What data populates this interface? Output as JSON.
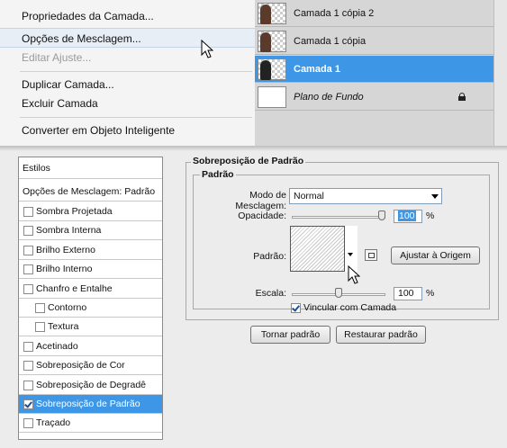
{
  "context_menu": {
    "items": [
      {
        "label": "Propriedades da Camada...",
        "state": "normal"
      },
      {
        "label": "Opções de Mesclagem...",
        "state": "highlighted"
      },
      {
        "label": "Editar Ajuste...",
        "state": "disabled"
      },
      {
        "label": "Duplicar Camada...",
        "state": "normal"
      },
      {
        "label": "Excluir Camada",
        "state": "normal"
      },
      {
        "label": "Converter em Objeto Inteligente",
        "state": "normal"
      }
    ]
  },
  "layers": {
    "items": [
      {
        "name": "Camada 1 cópia 2",
        "selected": false
      },
      {
        "name": "Camada 1 cópia",
        "selected": false
      },
      {
        "name": "Camada 1",
        "selected": true
      },
      {
        "name": "Plano de Fundo",
        "selected": false,
        "locked": true
      }
    ]
  },
  "styles_panel": {
    "header": "Estilos",
    "blending_options": "Opções de Mesclagem: Padrão",
    "items": [
      {
        "label": "Sombra Projetada",
        "checked": false,
        "indent": false
      },
      {
        "label": "Sombra Interna",
        "checked": false,
        "indent": false
      },
      {
        "label": "Brilho Externo",
        "checked": false,
        "indent": false
      },
      {
        "label": "Brilho Interno",
        "checked": false,
        "indent": false
      },
      {
        "label": "Chanfro e Entalhe",
        "checked": false,
        "indent": false
      },
      {
        "label": "Contorno",
        "checked": false,
        "indent": true
      },
      {
        "label": "Textura",
        "checked": false,
        "indent": true
      },
      {
        "label": "Acetinado",
        "checked": false,
        "indent": false
      },
      {
        "label": "Sobreposição de Cor",
        "checked": false,
        "indent": false
      },
      {
        "label": "Sobreposição de Degradê",
        "checked": false,
        "indent": false
      },
      {
        "label": "Sobreposição de Padrão",
        "checked": true,
        "indent": false,
        "selected": true
      },
      {
        "label": "Traçado",
        "checked": false,
        "indent": false
      }
    ]
  },
  "pattern_overlay": {
    "group_title": "Sobreposição de Padrão",
    "subgroup_title": "Padrão",
    "blend_mode_label": "Modo de Mesclagem:",
    "blend_mode_value": "Normal",
    "opacity_label": "Opacidade:",
    "opacity_value": "100",
    "opacity_level": 1.0,
    "percent": "%",
    "pattern_label": "Padrão:",
    "snap_button": "Ajustar à Origem",
    "scale_label": "Escala:",
    "scale_value": "100",
    "scale_level": 0.5,
    "link_label": "Vincular com Camada",
    "link_checked": true,
    "make_default_button": "Tornar padrão",
    "reset_default_button": "Restaurar padrão"
  },
  "colors": {
    "selection": "#3d96e6",
    "panel_bg": "#ececec"
  }
}
